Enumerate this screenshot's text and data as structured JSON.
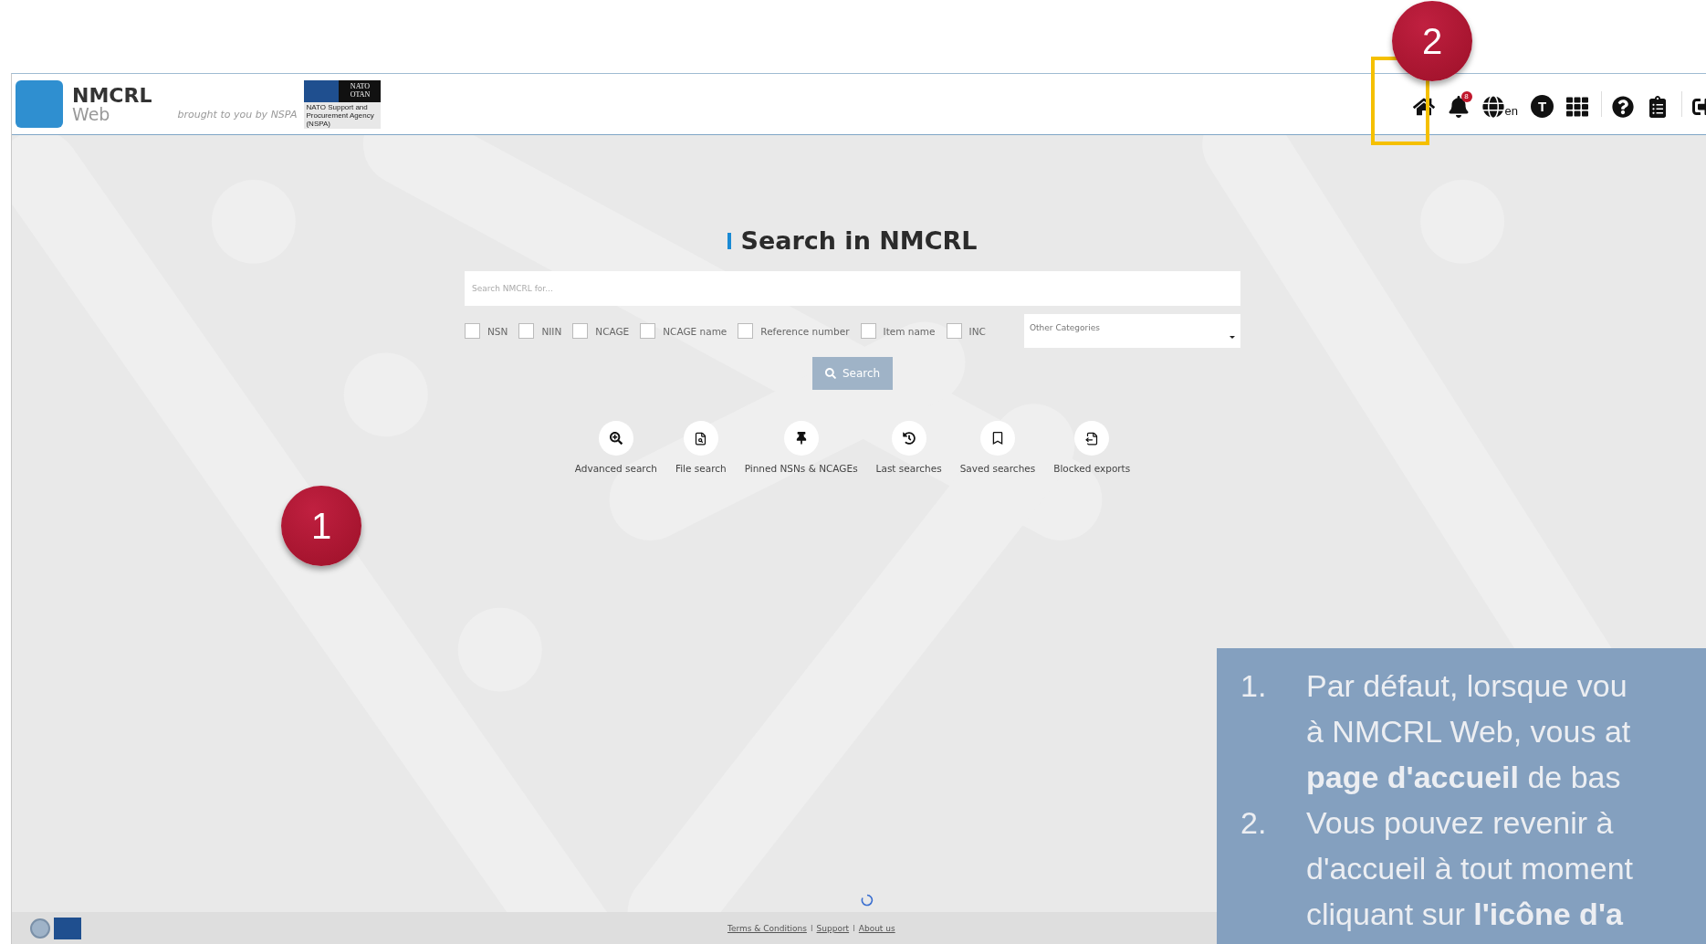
{
  "header": {
    "logo_title": "NMCRL",
    "logo_subtitle": "Web",
    "tagline": "brought to you by NSPA",
    "nato_logo": {
      "top": "NATO",
      "bottom": "OTAN",
      "caption": "NATO Support and Procurement Agency (NSPA)"
    }
  },
  "toolbar": [
    {
      "kind": "home"
    },
    {
      "kind": "bell",
      "badge": "8"
    },
    {
      "kind": "language",
      "label": "en"
    },
    {
      "kind": "user",
      "label": "T"
    },
    {
      "kind": "apps"
    },
    {
      "kind": "divider"
    },
    {
      "kind": "help"
    },
    {
      "kind": "clipboard"
    },
    {
      "kind": "divider"
    },
    {
      "kind": "logout"
    }
  ],
  "search": {
    "title": "Search in NMCRL",
    "placeholder": "Search NMCRL for...",
    "filters": [
      {
        "label": "NSN",
        "checked": false
      },
      {
        "label": "NIIN",
        "checked": false
      },
      {
        "label": "NCAGE",
        "checked": false
      },
      {
        "label": "NCAGE name",
        "checked": false
      },
      {
        "label": "Reference number",
        "checked": false
      },
      {
        "label": "Item name",
        "checked": false
      },
      {
        "label": "INC",
        "checked": false
      }
    ],
    "category_select": {
      "placeholder": "Other Categories"
    },
    "button": {
      "label": "Search",
      "disabled": true
    }
  },
  "shortcuts": [
    {
      "kind": "advanced",
      "label": "Advanced search"
    },
    {
      "kind": "file",
      "label": "File search"
    },
    {
      "kind": "pinned",
      "label": "Pinned NSNs & NCAGEs"
    },
    {
      "kind": "history",
      "label": "Last searches"
    },
    {
      "kind": "saved",
      "label": "Saved searches"
    },
    {
      "kind": "export",
      "label": "Blocked exports"
    }
  ],
  "footer": {
    "loading": true,
    "links": [
      "Terms & Conditions",
      "Support",
      "About us"
    ],
    "separators": [
      "I",
      "I"
    ]
  },
  "annotations": {
    "markers": [
      "1",
      "2"
    ],
    "note": [
      {
        "number": "1.",
        "lines": [
          "Par défaut, lorsque vou",
          "à NMCRL Web, vous at",
          "**page d'accueil** de bas"
        ]
      },
      {
        "number": "2.",
        "lines": [
          "Vous pouvez revenir à",
          "d'accueil à tout moment",
          "cliquant sur **l'icône d'a**"
        ]
      }
    ]
  }
}
